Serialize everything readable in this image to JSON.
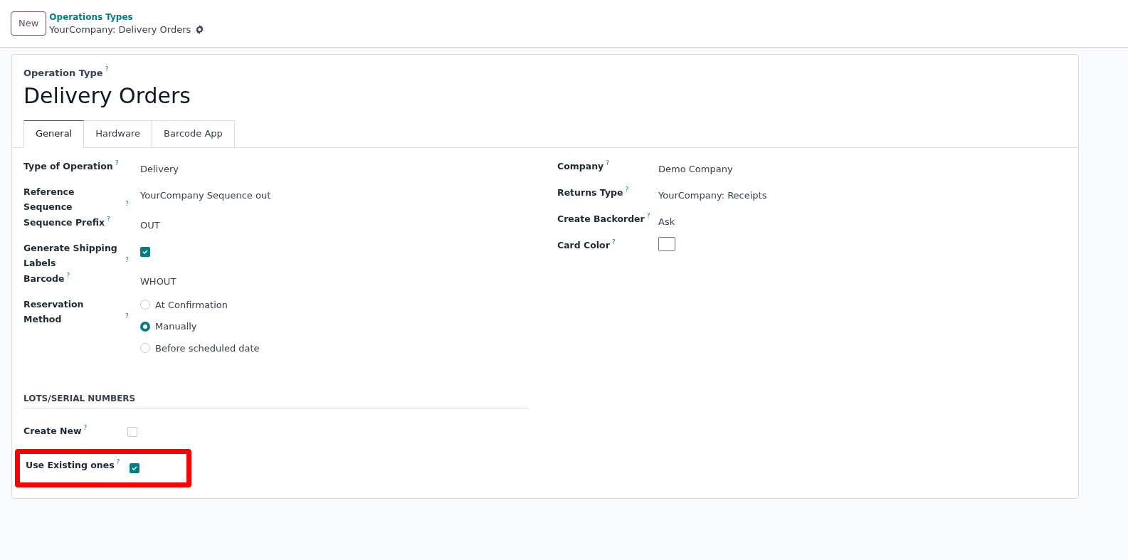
{
  "control_panel": {
    "new_button": "New",
    "breadcrumb": "Operations Types",
    "record_title": "YourCompany: Delivery Orders"
  },
  "form": {
    "overline": "Operation Type",
    "help": "?",
    "title": "Delivery Orders",
    "tabs": [
      {
        "label": "General",
        "selected": true
      },
      {
        "label": "Hardware",
        "selected": false
      },
      {
        "label": "Barcode App",
        "selected": false
      }
    ],
    "left_fields": [
      {
        "kind": "text",
        "label": "Type of Operation",
        "help": "?",
        "value": "Delivery"
      },
      {
        "kind": "text",
        "label": "Reference Sequence",
        "help": "?",
        "value": "YourCompany Sequence out"
      },
      {
        "kind": "text",
        "label": "Sequence Prefix",
        "help": "?",
        "value": "OUT"
      },
      {
        "kind": "checkbox",
        "label": "Generate Shipping Labels",
        "help": "?",
        "checked": true
      },
      {
        "kind": "text",
        "label": "Barcode",
        "help": "?",
        "value": "WHOUT"
      },
      {
        "kind": "radio",
        "label": "Reservation Method",
        "help": "?",
        "options": [
          {
            "label": "At Confirmation",
            "selected": false
          },
          {
            "label": "Manually",
            "selected": true
          },
          {
            "label": "Before scheduled date",
            "selected": false
          }
        ]
      }
    ],
    "right_fields": [
      {
        "kind": "text",
        "label": "Company",
        "help": "?",
        "value": "Demo Company"
      },
      {
        "kind": "text",
        "label": "Returns Type",
        "help": "?",
        "value": "YourCompany: Receipts"
      },
      {
        "kind": "text",
        "label": "Create Backorder",
        "help": "?",
        "value": "Ask"
      },
      {
        "kind": "color",
        "label": "Card Color",
        "help": "?",
        "color": "#ffffff"
      }
    ],
    "section": {
      "title": "LOTS/SERIAL NUMBERS",
      "fields": [
        {
          "kind": "checkbox",
          "label": "Create New",
          "help": "?",
          "checked": false,
          "highlighted": false
        },
        {
          "kind": "checkbox",
          "label": "Use Existing ones",
          "help": "?",
          "checked": true,
          "highlighted": true
        }
      ]
    }
  }
}
